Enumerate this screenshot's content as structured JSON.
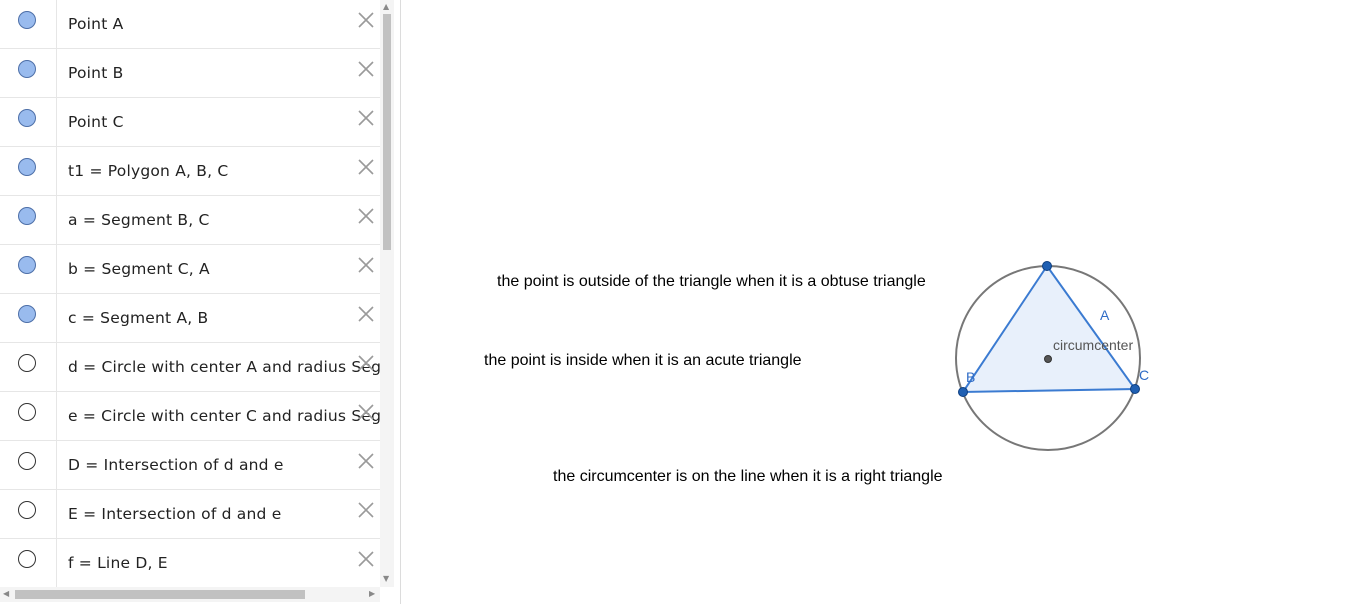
{
  "algebra": {
    "items": [
      {
        "label": "Point A",
        "visible": true
      },
      {
        "label": "Point B",
        "visible": true
      },
      {
        "label": "Point C",
        "visible": true
      },
      {
        "label": "t1 = Polygon A, B, C",
        "visible": true
      },
      {
        "label": "a = Segment B, C",
        "visible": true
      },
      {
        "label": "b = Segment C, A",
        "visible": true
      },
      {
        "label": "c = Segment A, B",
        "visible": true
      },
      {
        "label": "d = Circle with center A and radius Segm",
        "visible": false
      },
      {
        "label": "e = Circle with center C and radius Segm",
        "visible": false
      },
      {
        "label": "D = Intersection of d and e",
        "visible": false
      },
      {
        "label": "E = Intersection of d and e",
        "visible": false
      },
      {
        "label": "f = Line D, E",
        "visible": false
      }
    ]
  },
  "graphics": {
    "notes": [
      "the point is outside of the triangle when it is a obtuse triangle",
      "the point is inside when it is an acute triangle",
      "the circumcenter is on the line when it is a right triangle"
    ],
    "labels": {
      "vertex_a": "A",
      "vertex_b": "B",
      "vertex_c": "C",
      "circumcenter": "circumcenter"
    }
  },
  "colors": {
    "marble_on": "#99bbee",
    "triangle_stroke": "#3b7bd1",
    "triangle_fill": "#e8f0fb",
    "point_fill": "#1f5fb2",
    "circle_stroke": "#777777",
    "label_blue": "#2f6cc7"
  }
}
